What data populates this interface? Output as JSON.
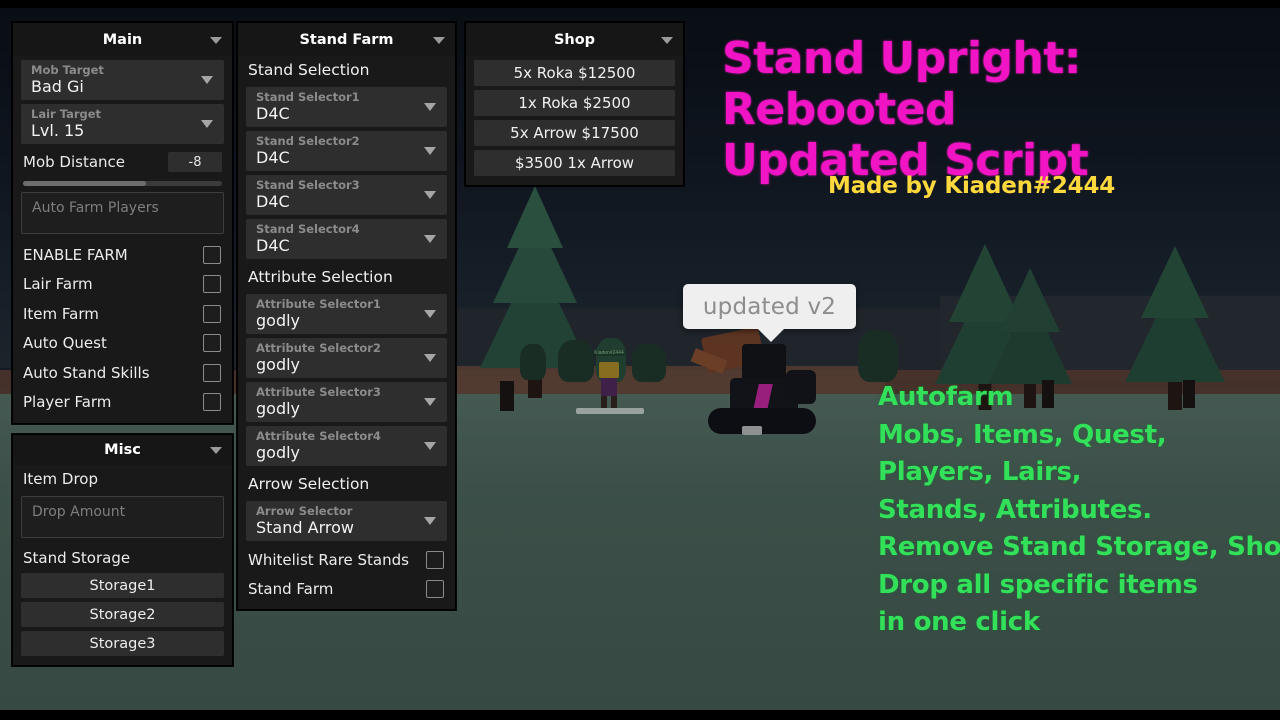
{
  "overlay": {
    "title_lines": [
      "Stand Upright: Rebooted",
      "Updated Script"
    ],
    "subtitle": "Made by Kiaden#2444",
    "title_color": "#f114c4",
    "subtitle_color": "#ffd83d",
    "features_color": "#32e05a",
    "features": [
      "Autofarm",
      "Mobs, Items, Quest,",
      "Players, Lairs,",
      "Stands, Attributes.",
      "Remove Stand Storage, Shop,",
      "Drop all specific items",
      "in one click"
    ]
  },
  "game": {
    "tooltip_text": "updated v2",
    "player_nametag": "Kiaden#2444"
  },
  "main_panel": {
    "title": "Main",
    "collapse_icon": "chevron-down-icon",
    "mob_target": {
      "label": "Mob Target",
      "value": "Bad Gi"
    },
    "lair_target": {
      "label": "Lair Target",
      "value": "Lvl. 15"
    },
    "mob_distance": {
      "label": "Mob Distance",
      "value": "-8",
      "fill_percent": 62
    },
    "auto_farm_players": {
      "placeholder": "Auto Farm Players",
      "value": ""
    },
    "toggles": [
      {
        "label": "ENABLE FARM",
        "checked": false
      },
      {
        "label": "Lair Farm",
        "checked": false
      },
      {
        "label": "Item Farm",
        "checked": false
      },
      {
        "label": "Auto Quest",
        "checked": false
      },
      {
        "label": "Auto Stand Skills",
        "checked": false
      },
      {
        "label": "Player Farm",
        "checked": false
      }
    ]
  },
  "misc_panel": {
    "title": "Misc",
    "collapse_icon": "chevron-down-icon",
    "item_drop_label": "Item Drop",
    "drop_amount": {
      "placeholder": "Drop Amount",
      "value": ""
    },
    "stand_storage_label": "Stand Storage",
    "storage_buttons": [
      "Storage1",
      "Storage2",
      "Storage3"
    ]
  },
  "stand_farm_panel": {
    "title": "Stand Farm",
    "collapse_icon": "chevron-down-icon",
    "stand_selection_header": "Stand Selection",
    "stand_selectors": [
      {
        "label": "Stand Selector1",
        "value": "D4C"
      },
      {
        "label": "Stand Selector2",
        "value": "D4C"
      },
      {
        "label": "Stand Selector3",
        "value": "D4C"
      },
      {
        "label": "Stand Selector4",
        "value": "D4C"
      }
    ],
    "attribute_selection_header": "Attribute Selection",
    "attribute_selectors": [
      {
        "label": "Attribute Selector1",
        "value": "godly"
      },
      {
        "label": "Attribute Selector2",
        "value": "godly"
      },
      {
        "label": "Attribute Selector3",
        "value": "godly"
      },
      {
        "label": "Attribute Selector4",
        "value": "godly"
      }
    ],
    "arrow_selection_header": "Arrow Selection",
    "arrow_selector": {
      "label": "Arrow Selector",
      "value": "Stand Arrow"
    },
    "toggles": [
      {
        "label": "Whitelist Rare Stands",
        "checked": false
      },
      {
        "label": "Stand Farm",
        "checked": false
      }
    ]
  },
  "shop_panel": {
    "title": "Shop",
    "collapse_icon": "chevron-down-icon",
    "buttons": [
      "5x Roka $12500",
      "1x Roka $2500",
      "5x Arrow $17500",
      "$3500 1x Arrow"
    ]
  }
}
